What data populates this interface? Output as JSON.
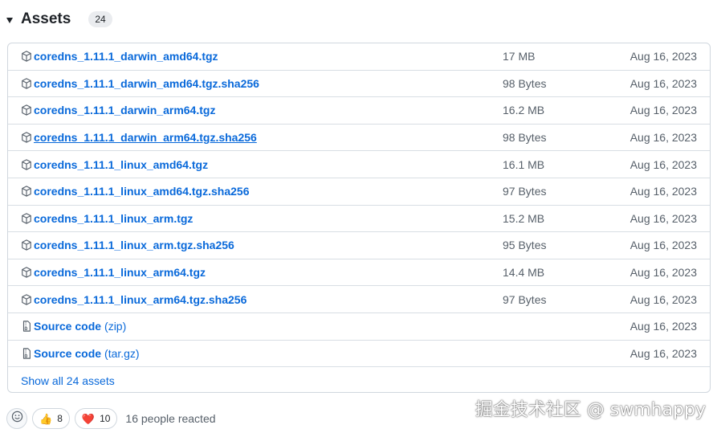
{
  "header": {
    "title": "Assets",
    "count": "24"
  },
  "assets": [
    {
      "name": "coredns_1.11.1_darwin_amd64.tgz",
      "size": "17 MB",
      "date": "Aug 16, 2023",
      "icon": "package-icon"
    },
    {
      "name": "coredns_1.11.1_darwin_amd64.tgz.sha256",
      "size": "98 Bytes",
      "date": "Aug 16, 2023",
      "icon": "package-icon"
    },
    {
      "name": "coredns_1.11.1_darwin_arm64.tgz",
      "size": "16.2 MB",
      "date": "Aug 16, 2023",
      "icon": "package-icon"
    },
    {
      "name": "coredns_1.11.1_darwin_arm64.tgz.sha256",
      "size": "98 Bytes",
      "date": "Aug 16, 2023",
      "icon": "package-icon"
    },
    {
      "name": "coredns_1.11.1_linux_amd64.tgz",
      "size": "16.1 MB",
      "date": "Aug 16, 2023",
      "icon": "package-icon"
    },
    {
      "name": "coredns_1.11.1_linux_amd64.tgz.sha256",
      "size": "97 Bytes",
      "date": "Aug 16, 2023",
      "icon": "package-icon"
    },
    {
      "name": "coredns_1.11.1_linux_arm.tgz",
      "size": "15.2 MB",
      "date": "Aug 16, 2023",
      "icon": "package-icon"
    },
    {
      "name": "coredns_1.11.1_linux_arm.tgz.sha256",
      "size": "95 Bytes",
      "date": "Aug 16, 2023",
      "icon": "package-icon"
    },
    {
      "name": "coredns_1.11.1_linux_arm64.tgz",
      "size": "14.4 MB",
      "date": "Aug 16, 2023",
      "icon": "package-icon"
    },
    {
      "name": "coredns_1.11.1_linux_arm64.tgz.sha256",
      "size": "97 Bytes",
      "date": "Aug 16, 2023",
      "icon": "package-icon"
    }
  ],
  "source_code": [
    {
      "name": "Source code",
      "suffix": "(zip)",
      "date": "Aug 16, 2023",
      "icon": "file-zip-icon"
    },
    {
      "name": "Source code",
      "suffix": "(tar.gz)",
      "date": "Aug 16, 2023",
      "icon": "file-zip-icon"
    }
  ],
  "show_all": "Show all 24 assets",
  "reactions": {
    "add_icon": "smiley-icon",
    "items": [
      {
        "emoji": "👍",
        "count": "8",
        "icon": "thumbs-up-icon"
      },
      {
        "emoji": "❤️",
        "count": "10",
        "icon": "heart-icon"
      }
    ],
    "summary": "16 people reacted"
  },
  "watermark": "掘金技术社区 @ swmhappy",
  "colors": {
    "link": "#0969da",
    "muted": "#57606a",
    "border": "#d0d7de"
  }
}
